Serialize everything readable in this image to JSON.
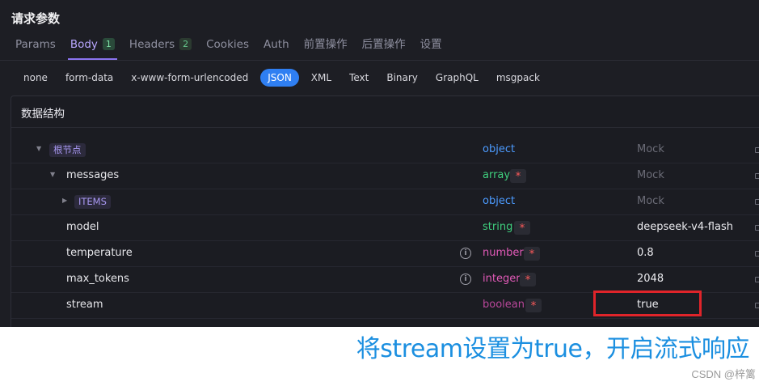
{
  "section_title": "请求参数",
  "tabs": [
    {
      "label": "Params",
      "count": "",
      "active": false
    },
    {
      "label": "Body",
      "count": "1",
      "active": true
    },
    {
      "label": "Headers",
      "count": "2",
      "active": false
    },
    {
      "label": "Cookies",
      "count": "",
      "active": false
    },
    {
      "label": "Auth",
      "count": "",
      "active": false
    },
    {
      "label": "前置操作",
      "count": "",
      "active": false
    },
    {
      "label": "后置操作",
      "count": "",
      "active": false
    },
    {
      "label": "设置",
      "count": "",
      "active": false
    }
  ],
  "body_types": [
    "none",
    "form-data",
    "x-www-form-urlencoded",
    "JSON",
    "XML",
    "Text",
    "Binary",
    "GraphQL",
    "msgpack"
  ],
  "body_type_active": "JSON",
  "panel_title": "数据结构",
  "rows": [
    {
      "name": "根节点",
      "type": "object",
      "required": false,
      "value": "",
      "mock": "Mock",
      "info": false
    },
    {
      "name": "messages",
      "type": "array",
      "required": true,
      "value": "",
      "mock": "Mock",
      "info": false
    },
    {
      "name": "ITEMS",
      "type": "object",
      "required": false,
      "value": "",
      "mock": "Mock",
      "info": false
    },
    {
      "name": "model",
      "type": "string",
      "required": true,
      "value": "deepseek-v4-flash",
      "mock": "",
      "info": false
    },
    {
      "name": "temperature",
      "type": "number",
      "required": true,
      "value": "0.8",
      "mock": "",
      "info": true
    },
    {
      "name": "max_tokens",
      "type": "integer",
      "required": true,
      "value": "2048",
      "mock": "",
      "info": true
    },
    {
      "name": "stream",
      "type": "boolean",
      "required": true,
      "value": "true",
      "mock": "",
      "info": false
    }
  ],
  "required_mark": "*",
  "caption": "将stream设置为true，开启流式响应",
  "watermark": "CSDN @梓篱",
  "colors": {
    "accent": "#2f7ff2",
    "highlight_box": "#e0242a",
    "caption": "#1b8fe0"
  }
}
